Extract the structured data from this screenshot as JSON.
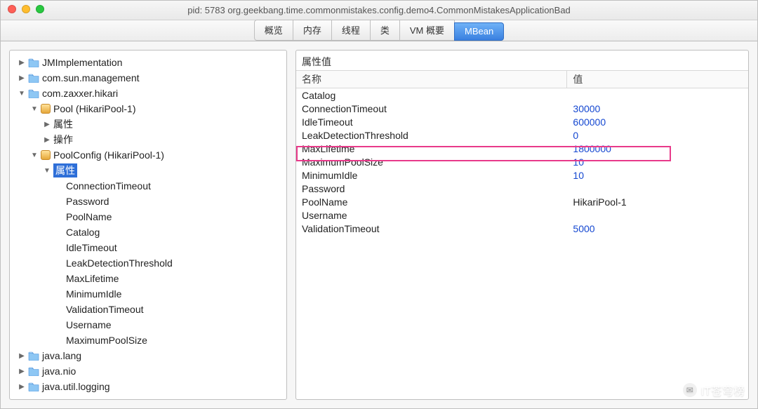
{
  "title": "pid: 5783 org.geekbang.time.commonmistakes.config.demo4.CommonMistakesApplicationBad",
  "tabs": [
    {
      "label": "概览"
    },
    {
      "label": "内存"
    },
    {
      "label": "线程"
    },
    {
      "label": "类"
    },
    {
      "label": "VM 概要"
    },
    {
      "label": "MBean"
    }
  ],
  "active_tab_index": 5,
  "tree": {
    "nodes": [
      {
        "depth": 0,
        "disclosure": "closed",
        "icon": "folder",
        "label": "JMImplementation"
      },
      {
        "depth": 0,
        "disclosure": "closed",
        "icon": "folder",
        "label": "com.sun.management"
      },
      {
        "depth": 0,
        "disclosure": "open",
        "icon": "folder",
        "label": "com.zaxxer.hikari"
      },
      {
        "depth": 1,
        "disclosure": "open",
        "icon": "bean",
        "label": "Pool (HikariPool-1)"
      },
      {
        "depth": 2,
        "disclosure": "closed",
        "icon": "none",
        "label": "属性"
      },
      {
        "depth": 2,
        "disclosure": "closed",
        "icon": "none",
        "label": "操作"
      },
      {
        "depth": 1,
        "disclosure": "open",
        "icon": "bean",
        "label": "PoolConfig (HikariPool-1)"
      },
      {
        "depth": 2,
        "disclosure": "open",
        "icon": "none",
        "label": "属性",
        "selected": true
      },
      {
        "depth": 3,
        "disclosure": "none",
        "icon": "none",
        "label": "ConnectionTimeout"
      },
      {
        "depth": 3,
        "disclosure": "none",
        "icon": "none",
        "label": "Password"
      },
      {
        "depth": 3,
        "disclosure": "none",
        "icon": "none",
        "label": "PoolName"
      },
      {
        "depth": 3,
        "disclosure": "none",
        "icon": "none",
        "label": "Catalog"
      },
      {
        "depth": 3,
        "disclosure": "none",
        "icon": "none",
        "label": "IdleTimeout"
      },
      {
        "depth": 3,
        "disclosure": "none",
        "icon": "none",
        "label": "LeakDetectionThreshold"
      },
      {
        "depth": 3,
        "disclosure": "none",
        "icon": "none",
        "label": "MaxLifetime"
      },
      {
        "depth": 3,
        "disclosure": "none",
        "icon": "none",
        "label": "MinimumIdle"
      },
      {
        "depth": 3,
        "disclosure": "none",
        "icon": "none",
        "label": "ValidationTimeout"
      },
      {
        "depth": 3,
        "disclosure": "none",
        "icon": "none",
        "label": "Username"
      },
      {
        "depth": 3,
        "disclosure": "none",
        "icon": "none",
        "label": "MaximumPoolSize"
      },
      {
        "depth": 0,
        "disclosure": "closed",
        "icon": "folder",
        "label": "java.lang"
      },
      {
        "depth": 0,
        "disclosure": "closed",
        "icon": "folder",
        "label": "java.nio"
      },
      {
        "depth": 0,
        "disclosure": "closed",
        "icon": "folder",
        "label": "java.util.logging"
      }
    ]
  },
  "attributes_panel": {
    "title": "属性值",
    "columns": {
      "name": "名称",
      "value": "值"
    },
    "rows": [
      {
        "name": "Catalog",
        "value": ""
      },
      {
        "name": "ConnectionTimeout",
        "value": "30000"
      },
      {
        "name": "IdleTimeout",
        "value": "600000"
      },
      {
        "name": "LeakDetectionThreshold",
        "value": "0"
      },
      {
        "name": "MaxLifetime",
        "value": "1800000"
      },
      {
        "name": "MaximumPoolSize",
        "value": "10"
      },
      {
        "name": "MinimumIdle",
        "value": "10"
      },
      {
        "name": "Password",
        "value": ""
      },
      {
        "name": "PoolName",
        "value": "HikariPool-1"
      },
      {
        "name": "Username",
        "value": ""
      },
      {
        "name": "ValidationTimeout",
        "value": "5000"
      }
    ],
    "highlight_row_index": 5
  },
  "watermark": "IT苍穹榜"
}
